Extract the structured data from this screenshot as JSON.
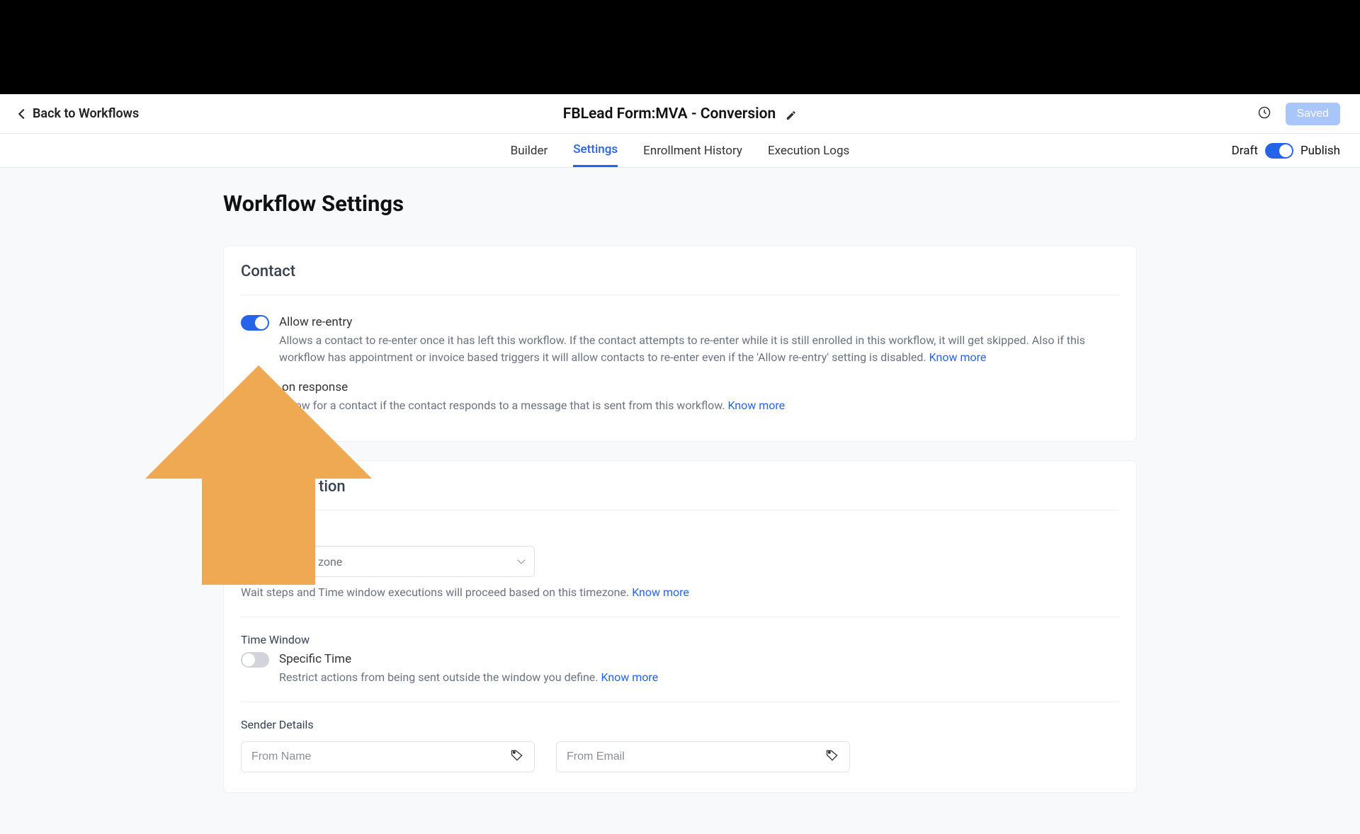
{
  "header": {
    "back_label": "Back to Workflows",
    "title": "FBLead Form:MVA - Conversion",
    "saved_label": "Saved"
  },
  "tabs": {
    "items": [
      "Builder",
      "Settings",
      "Enrollment History",
      "Execution Logs"
    ],
    "active_index": 1,
    "draft_label": "Draft",
    "publish_label": "Publish"
  },
  "page": {
    "heading": "Workflow Settings"
  },
  "contact": {
    "title": "Contact",
    "allow_reentry": {
      "label": "Allow re-entry",
      "desc": "Allows a contact to re-enter once it has left this workflow. If the contact attempts to re-enter while it is still enrolled in this workflow, it will get skipped. Also if this workflow has appointment or invoice based triggers it will allow contacts to re-enter even if the 'Allow re-entry' setting is disabled.",
      "know": "Know more"
    },
    "stop_on_response": {
      "label_suffix": "on response",
      "desc_suffix": "rkflow for a contact if the contact responds to a message that is sent from this workflow.",
      "know": "Know more"
    }
  },
  "communication": {
    "title_suffix": "tion",
    "timezone": {
      "selected_suffix": "zone",
      "desc": "Wait steps and Time window executions will proceed based on this timezone.",
      "know": "Know more"
    },
    "time_window": {
      "label": "Time Window",
      "specific_label": "Specific Time",
      "desc": "Restrict actions from being sent outside the window you define.",
      "know": "Know more"
    },
    "sender": {
      "label": "Sender Details",
      "from_name_placeholder": "From Name",
      "from_email_placeholder": "From Email"
    }
  },
  "arrow": {
    "color": "#f0a953"
  }
}
